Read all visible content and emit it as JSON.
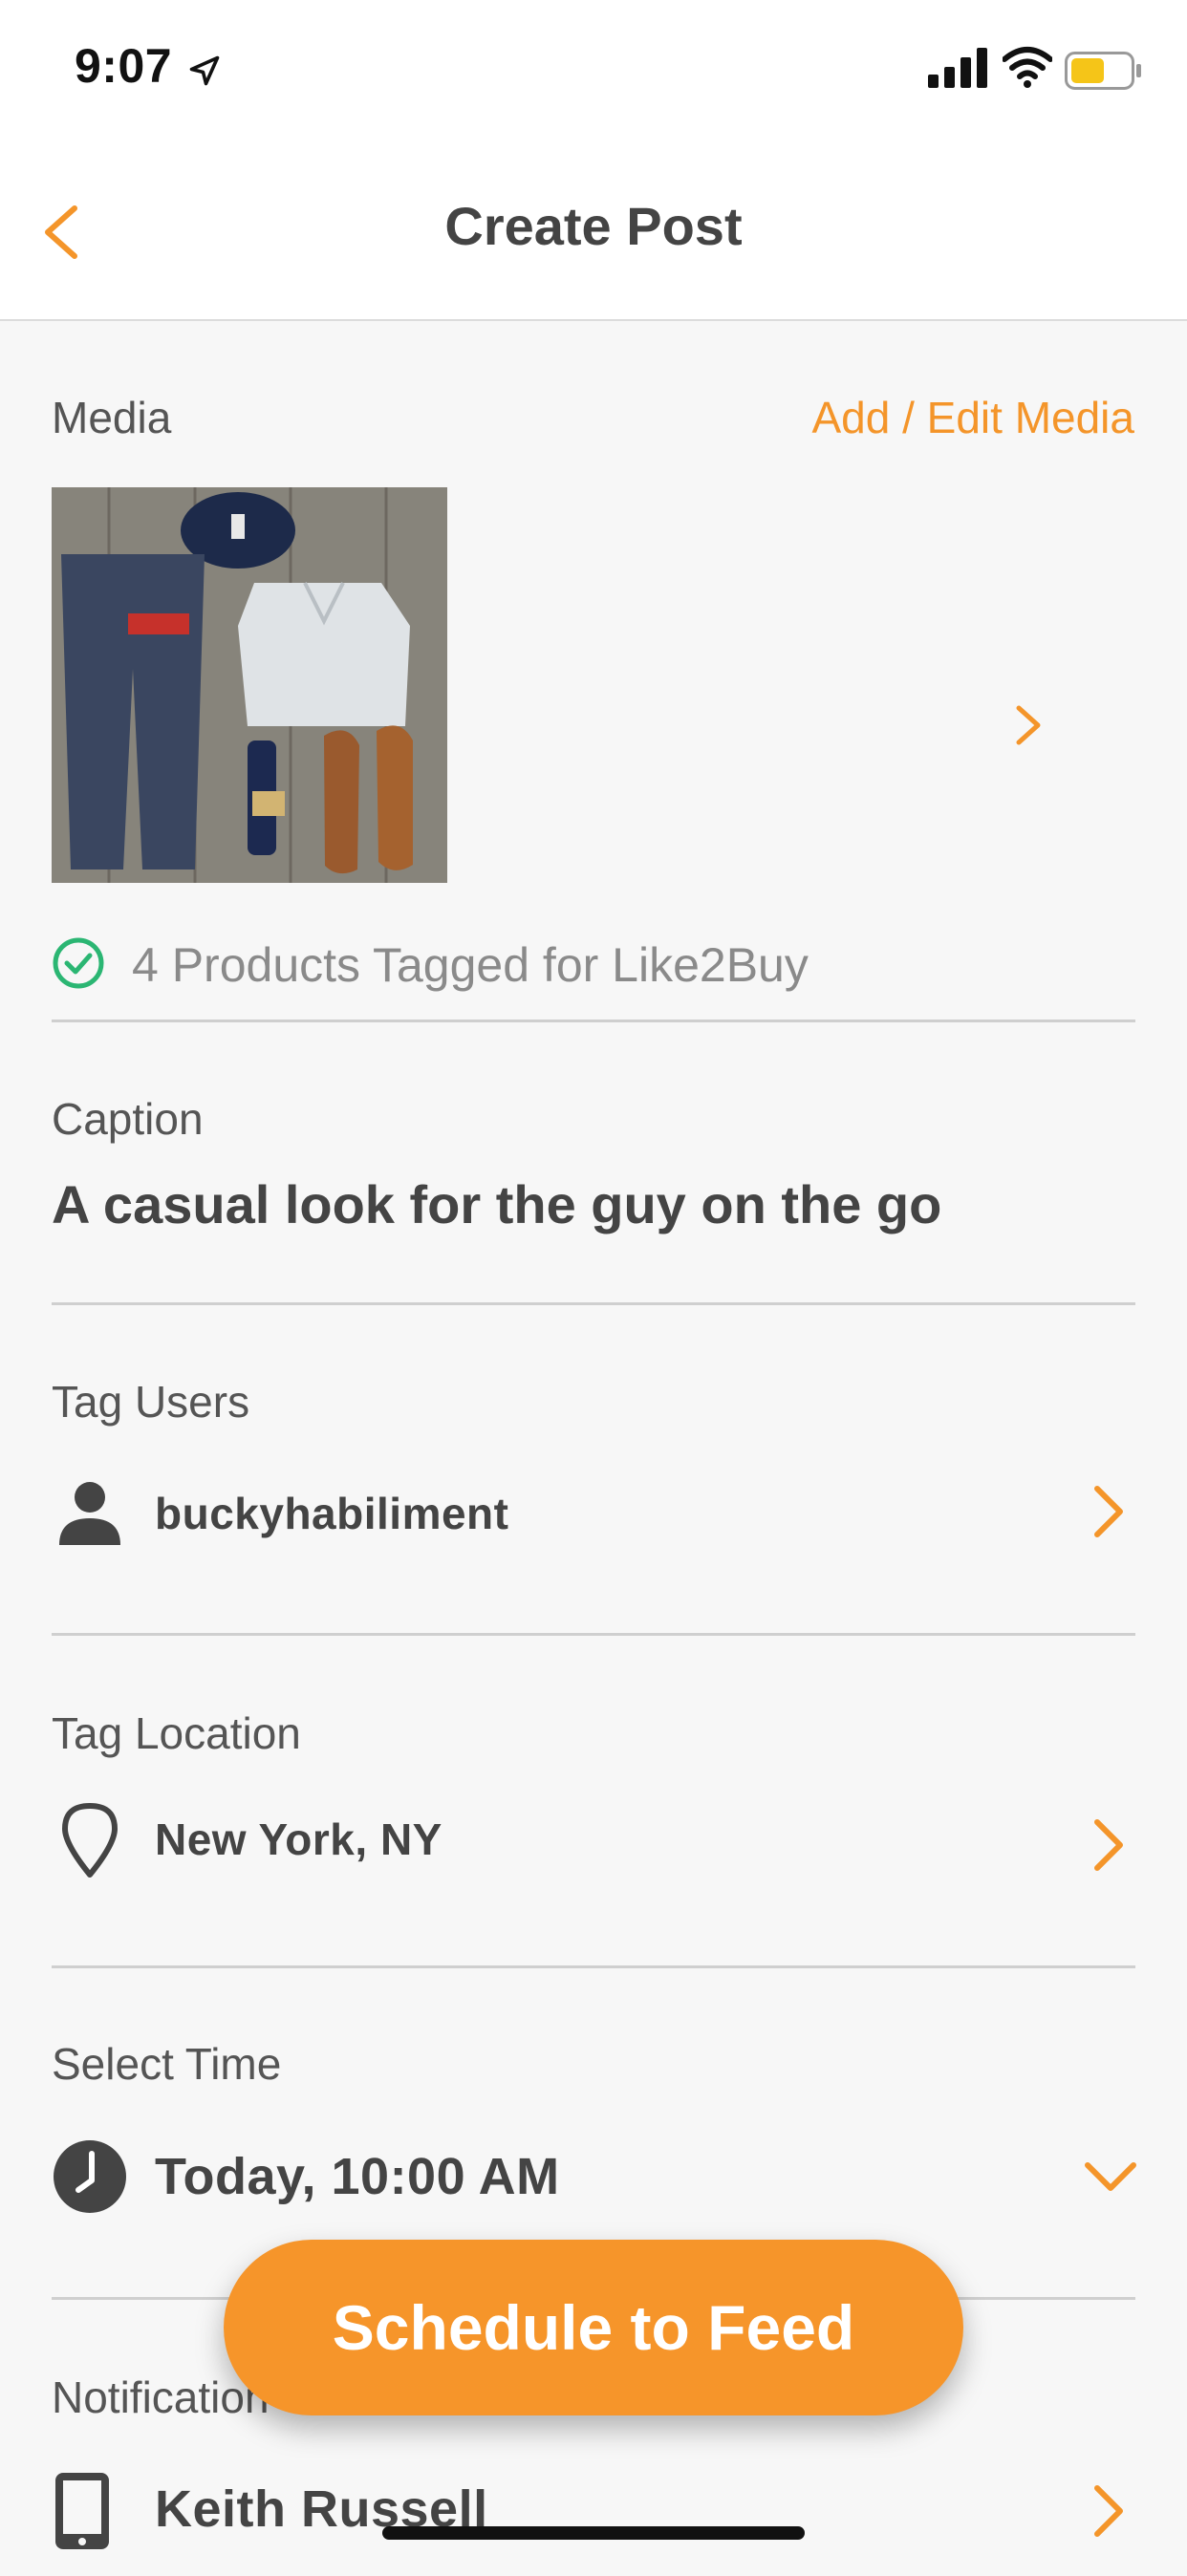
{
  "status_bar": {
    "time": "9:07"
  },
  "nav": {
    "title": "Create Post"
  },
  "media": {
    "label": "Media",
    "edit_link": "Add / Edit Media",
    "tagged_text": "4 Products Tagged for Like2Buy"
  },
  "caption": {
    "label": "Caption",
    "text": "A casual look for the guy on the go"
  },
  "tag_users": {
    "label": "Tag Users",
    "value": "buckyhabiliment"
  },
  "tag_location": {
    "label": "Tag Location",
    "value": "New York, NY"
  },
  "select_time": {
    "label": "Select Time",
    "value": "Today, 10:00 AM"
  },
  "notification": {
    "label": "Notification",
    "value": "Keith Russell"
  },
  "primary_button": {
    "label": "Schedule to Feed"
  },
  "colors": {
    "accent": "#f6952a",
    "success": "#2bb673"
  },
  "icons": {
    "back": "chevron-left-icon",
    "media_next": "chevron-right-icon",
    "tagged": "check-circle-icon",
    "user": "person-icon",
    "location": "map-pin-icon",
    "time": "clock-icon",
    "time_expand": "chevron-down-icon",
    "notification": "phone-icon"
  }
}
